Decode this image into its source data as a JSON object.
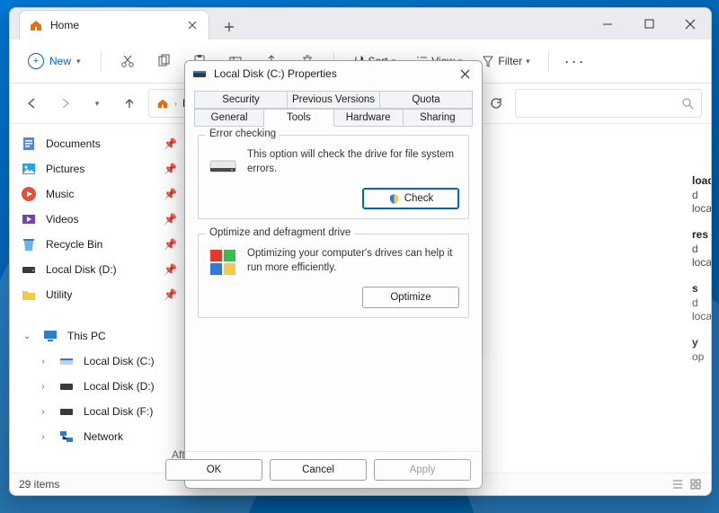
{
  "window": {
    "tab_title": "Home",
    "new_tab_tooltip": "New tab"
  },
  "toolbar": {
    "new_label": "New",
    "sort_label": "Sort",
    "view_label": "View",
    "filter_label": "Filter"
  },
  "address": {
    "crumb_home": "Hom",
    "search_placeholder": ""
  },
  "sidebar": {
    "quick": [
      {
        "label": "Documents"
      },
      {
        "label": "Pictures"
      },
      {
        "label": "Music"
      },
      {
        "label": "Videos"
      },
      {
        "label": "Recycle Bin"
      },
      {
        "label": "Local Disk (D:)"
      },
      {
        "label": "Utility"
      }
    ],
    "thispc_label": "This PC",
    "drives": [
      {
        "label": "Local Disk (C:)"
      },
      {
        "label": "Local Disk (D:)"
      },
      {
        "label": "Local Disk (F:)"
      }
    ],
    "network_label": "Network"
  },
  "content_peek": {
    "downloads": "loads",
    "downloads_sub": "d locally",
    "pictures": "res",
    "pictures_sub": "d locally",
    "videos": "s",
    "videos_sub": "d locally",
    "desktop": "y",
    "desktop_sub": "op",
    "pinned_hint": "After you've pinned some files, we'll show them here."
  },
  "status": {
    "items": "29 items"
  },
  "dialog": {
    "title": "Local Disk (C:) Properties",
    "tabs_back": [
      "Security",
      "Previous Versions",
      "Quota"
    ],
    "tabs_front": [
      "General",
      "Tools",
      "Hardware",
      "Sharing"
    ],
    "active_tab": "Tools",
    "error_group": "Error checking",
    "error_text": "This option will check the drive for file system errors.",
    "check_btn": "Check",
    "opt_group": "Optimize and defragment drive",
    "opt_text": "Optimizing your computer's drives can help it run more efficiently.",
    "opt_btn": "Optimize",
    "ok": "OK",
    "cancel": "Cancel",
    "apply": "Apply"
  }
}
